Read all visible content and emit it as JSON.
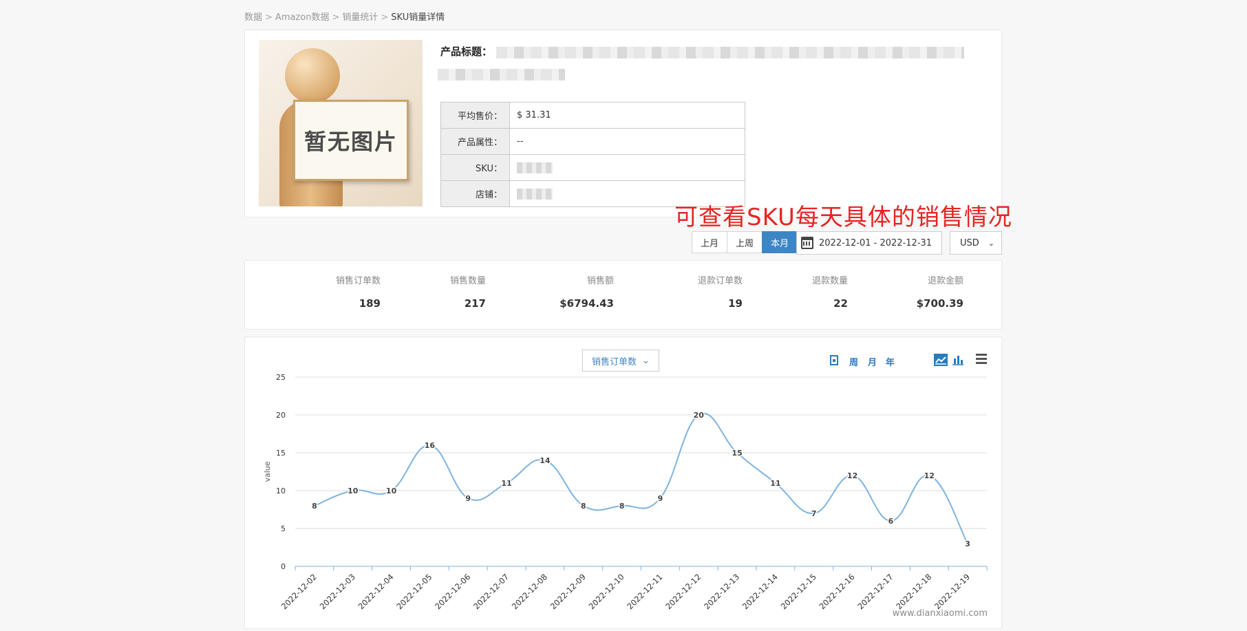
{
  "breadcrumb": [
    "数据",
    "Amazon数据",
    "销量统计",
    "SKU销量详情"
  ],
  "breadcrumb_sep": ">",
  "product": {
    "image_text": "暂无图片",
    "title_label": "产品标题：",
    "info": [
      {
        "key": "平均售价：",
        "value": "$ 31.31"
      },
      {
        "key": "产品属性：",
        "value": "--"
      },
      {
        "key": "SKU：",
        "value": ""
      },
      {
        "key": "店铺：",
        "value": ""
      }
    ]
  },
  "annotation": "可查看SKU每天具体的销售情况",
  "range_buttons": [
    {
      "label": "上月",
      "active": false
    },
    {
      "label": "上周",
      "active": false
    },
    {
      "label": "本月",
      "active": true
    }
  ],
  "date_range": "2022-12-01 - 2022-12-31",
  "currency": "USD",
  "stats": [
    {
      "label": "销售订单数",
      "value": "189"
    },
    {
      "label": "销售数量",
      "value": "217"
    },
    {
      "label": "销售额",
      "value": "$6794.43"
    },
    {
      "label": "退款订单数",
      "value": "19"
    },
    {
      "label": "退款数量",
      "value": "22"
    },
    {
      "label": "退款金额",
      "value": "$700.39"
    }
  ],
  "chart_controls": {
    "metric": "销售订单数",
    "periods": [
      "周",
      "月",
      "年"
    ]
  },
  "watermark": "www.dianxiaomi.com",
  "colors": {
    "accent": "#3d86c6",
    "line": "#7eb3de",
    "annotation": "#e52523"
  },
  "chart_data": {
    "type": "line",
    "ylabel": "value",
    "ylim": [
      0,
      25
    ],
    "yticks": [
      0,
      5,
      10,
      15,
      20,
      25
    ],
    "grid": true,
    "categories": [
      "2022-12-02",
      "2022-12-03",
      "2022-12-04",
      "2022-12-05",
      "2022-12-06",
      "2022-12-07",
      "2022-12-08",
      "2022-12-09",
      "2022-12-10",
      "2022-12-11",
      "2022-12-12",
      "2022-12-13",
      "2022-12-14",
      "2022-12-15",
      "2022-12-16",
      "2022-12-17",
      "2022-12-18",
      "2022-12-19"
    ],
    "values": [
      8,
      10,
      10,
      16,
      9,
      11,
      14,
      8,
      8,
      9,
      20,
      15,
      11,
      7,
      12,
      6,
      12,
      3
    ],
    "data_labels": true
  }
}
